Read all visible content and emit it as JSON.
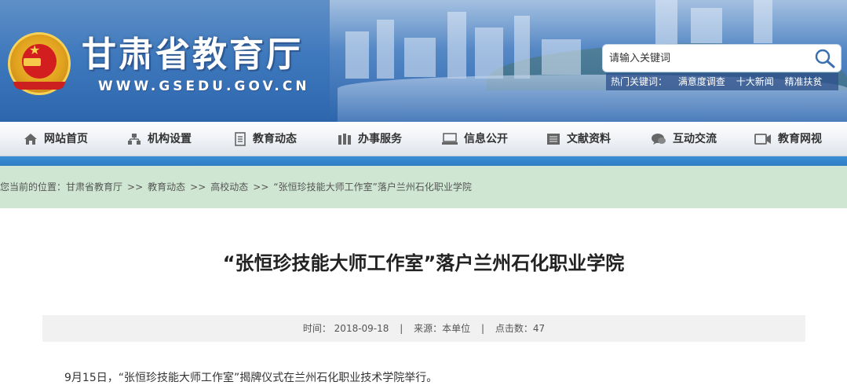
{
  "header": {
    "site_title": "甘肃省教育厅",
    "site_url": "WWW.GSEDU.GOV.CN",
    "search_placeholder": "请输入关键词",
    "hot_label": "热门关键词：",
    "hot_words": [
      "满意度调查",
      "十大新闻",
      "精准扶贫"
    ]
  },
  "nav": {
    "items": [
      {
        "label": "网站首页",
        "icon": "home-icon"
      },
      {
        "label": "机构设置",
        "icon": "org-chart-icon"
      },
      {
        "label": "教育动态",
        "icon": "document-icon"
      },
      {
        "label": "办事服务",
        "icon": "service-icon"
      },
      {
        "label": "信息公开",
        "icon": "monitor-icon"
      },
      {
        "label": "文献资料",
        "icon": "archive-icon"
      },
      {
        "label": "互动交流",
        "icon": "chat-icon"
      },
      {
        "label": "教育网视",
        "icon": "video-icon"
      }
    ]
  },
  "breadcrumb": {
    "prefix": "您当前的位置：",
    "items": [
      "甘肃省教育厅",
      "教育动态",
      "高校动态",
      "“张恒珍技能大师工作室”落户兰州石化职业学院"
    ],
    "separator": ">>"
  },
  "article": {
    "title": "“张恒珍技能大师工作室”落户兰州石化职业学院",
    "time_label": "时间：",
    "time_value": "2018-09-18",
    "source_label": "来源：",
    "source_value": "本单位",
    "hits_label": "点击数：",
    "hits_value": "47",
    "divider": "|",
    "first_paragraph": "9月15日，“张恒珍技能大师工作室”揭牌仪式在兰州石化职业技术学院举行。"
  },
  "colors": {
    "banner_blue": "#3f79bd",
    "nav_bar_blue": "#2f7dc4",
    "breadcrumb_green": "#cfe7d2",
    "meta_gray": "#f1f1f1"
  }
}
